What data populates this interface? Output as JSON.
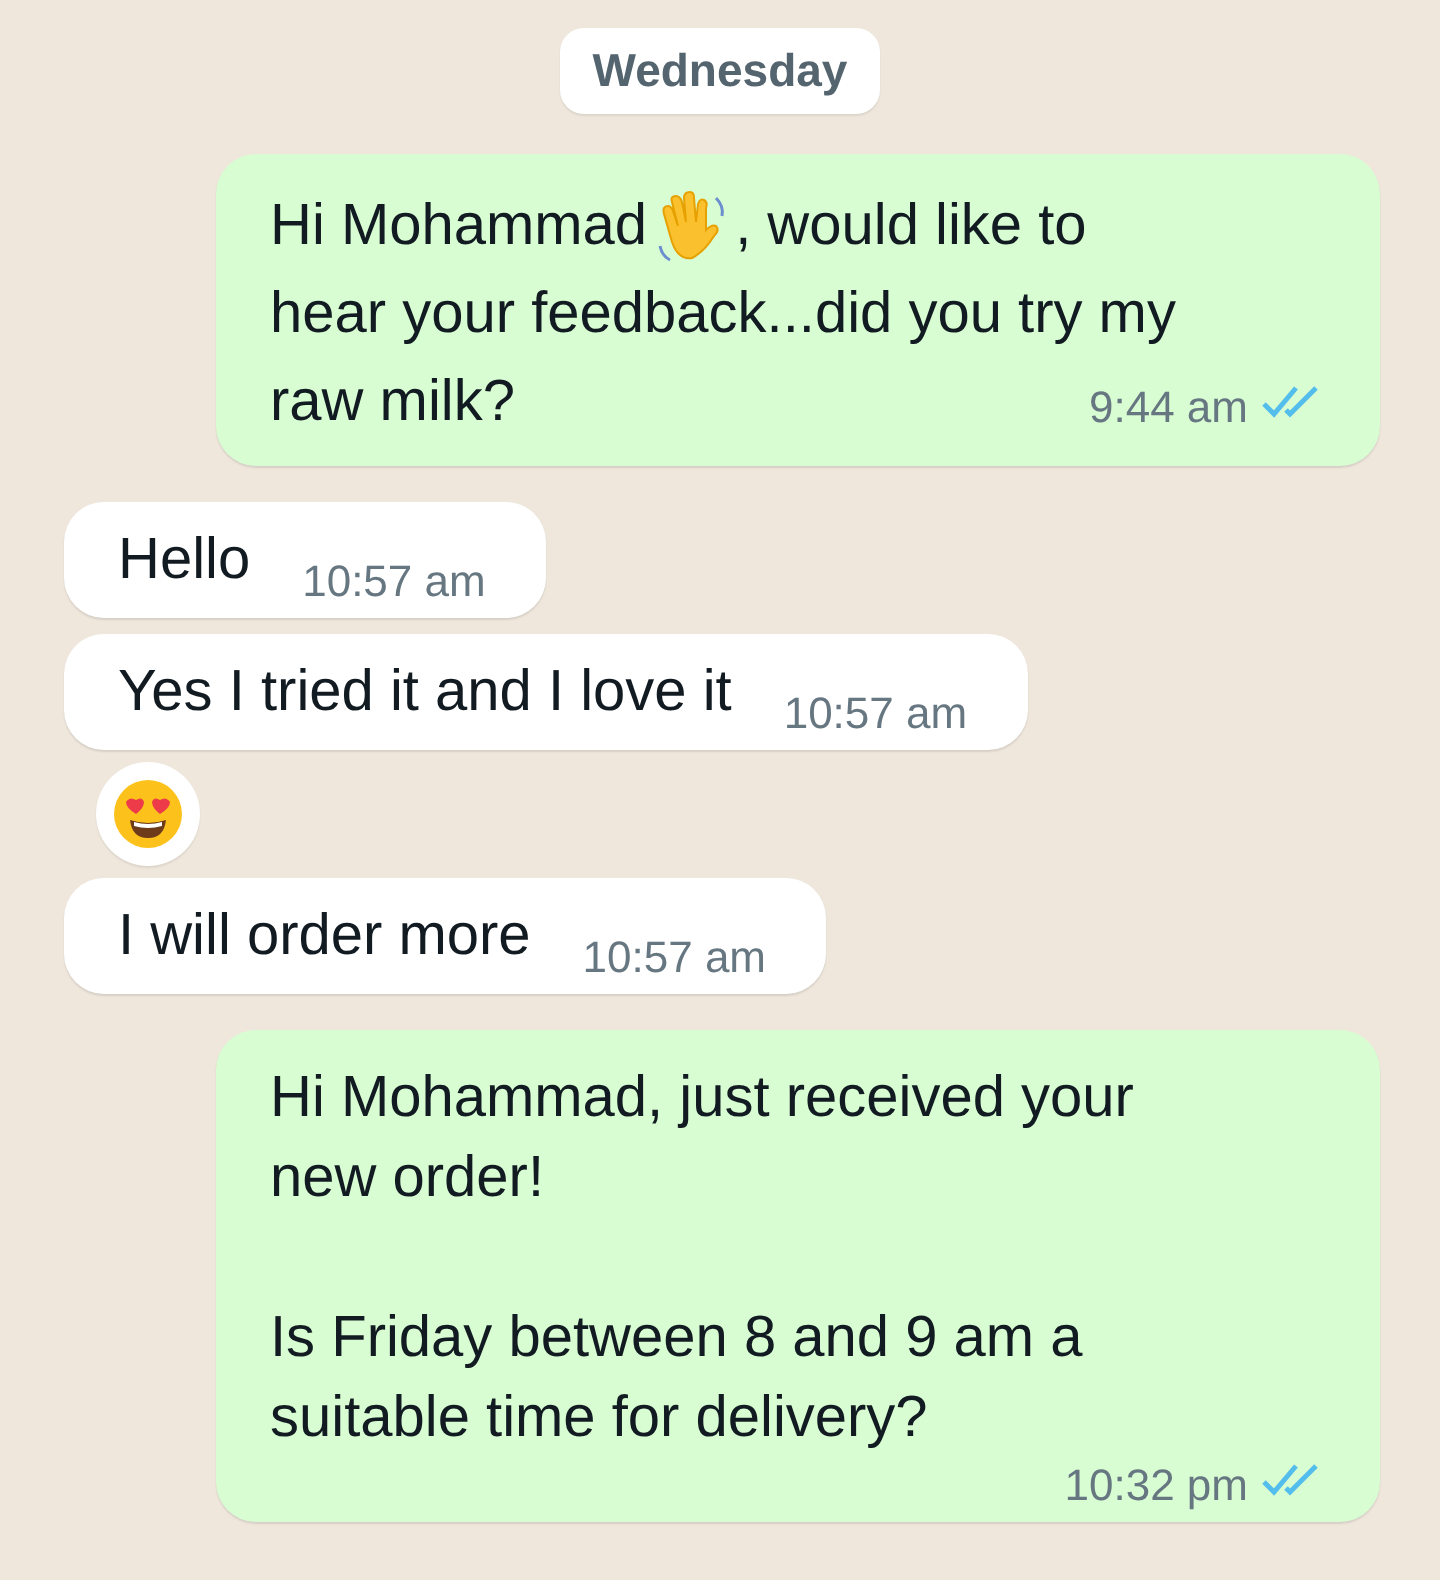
{
  "date_divider": "Wednesday",
  "messages": [
    {
      "kind": "sent",
      "lines": [
        [
          "Hi Mohammad",
          ", would like to"
        ],
        [
          "hear your feedback...did you try my"
        ],
        [
          "raw milk?"
        ]
      ],
      "time": "9:44 am",
      "read": true
    },
    {
      "kind": "received",
      "text": "Hello",
      "time": "10:57 am"
    },
    {
      "kind": "received",
      "text": "Yes I tried it and I love it",
      "time": "10:57 am",
      "reaction": true
    },
    {
      "kind": "received",
      "text": "I will order more",
      "time": "10:57 am"
    },
    {
      "kind": "sent",
      "text": "Hi Mohammad, just received your new order!\n\nIs Friday between 8 and 9 am a suitable time for delivery?",
      "time": "10:32 pm",
      "read": true
    }
  ]
}
